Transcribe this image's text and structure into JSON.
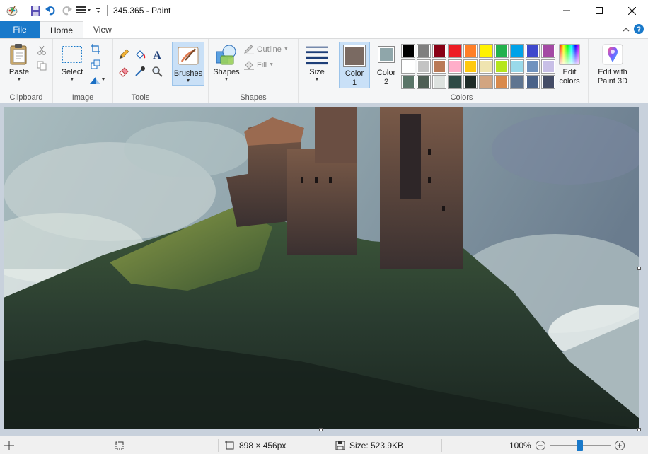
{
  "window": {
    "title": "345.365 - Paint"
  },
  "tabs": [
    {
      "label": "File"
    },
    {
      "label": "Home"
    },
    {
      "label": "View"
    }
  ],
  "ribbon": {
    "clipboard": {
      "group_label": "Clipboard",
      "paste_label": "Paste"
    },
    "image": {
      "group_label": "Image",
      "select_label": "Select"
    },
    "tools": {
      "group_label": "Tools"
    },
    "brushes": {
      "label": "Brushes"
    },
    "shapes": {
      "group_label": "Shapes",
      "shapes_label": "Shapes",
      "outline_label": "Outline",
      "fill_label": "Fill"
    },
    "size": {
      "label": "Size"
    },
    "colors": {
      "group_label": "Colors",
      "color1_label": "Color",
      "color1_num": "1",
      "color2_label": "Color",
      "color2_num": "2",
      "color1": "#7a6a62",
      "color2": "#8fa6aa",
      "edit_colors_line1": "Edit",
      "edit_colors_line2": "colors",
      "palette": [
        "#000000",
        "#7f7f7f",
        "#880015",
        "#ed1c24",
        "#ff7f27",
        "#fff200",
        "#22b14c",
        "#00a2e8",
        "#3f48cc",
        "#a349a4",
        "#ffffff",
        "#c3c3c3",
        "#b97a57",
        "#ffaec9",
        "#ffc90e",
        "#efe4b0",
        "#b5e61d",
        "#99d9ea",
        "#7092be",
        "#c8bfe7",
        "#5a7568",
        "#4f5f55",
        "#dde2df",
        "#2e4a45",
        "#1e2b27",
        "#d2a581",
        "#d98a4c",
        "#5f7590",
        "#4a6288",
        "#444c66"
      ]
    },
    "paint3d": {
      "line1": "Edit with",
      "line2": "Paint 3D"
    }
  },
  "status": {
    "image_size": "898 × 456px",
    "file_size": "Size: 523.9KB",
    "zoom": "100%"
  }
}
